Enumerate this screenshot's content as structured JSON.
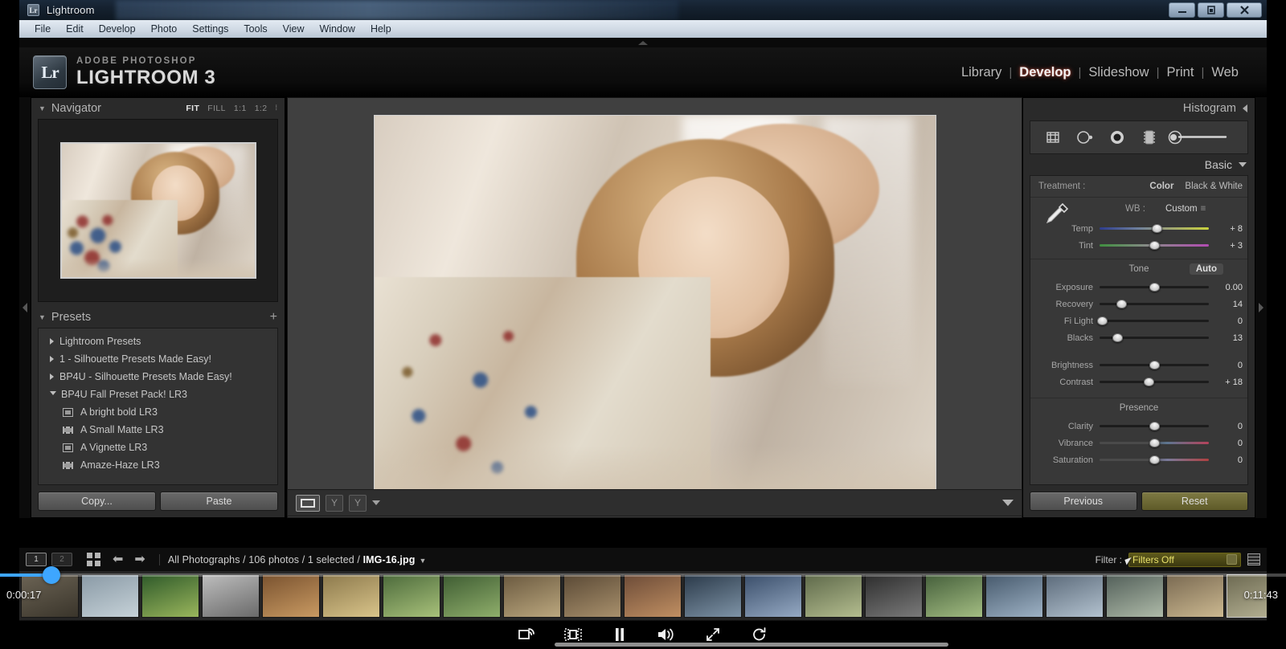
{
  "window": {
    "title": "Lightroom",
    "app_icon": "Lr",
    "minimize": "—",
    "restore": "❐",
    "close": "✕"
  },
  "menubar": {
    "items": [
      "File",
      "Edit",
      "Develop",
      "Photo",
      "Settings",
      "Tools",
      "View",
      "Window",
      "Help"
    ]
  },
  "app": {
    "brand_sub": "ADOBE PHOTOSHOP",
    "brand_main": "LIGHTROOM 3",
    "logo_mark": "Lr",
    "modules": [
      {
        "label": "Library",
        "active": false
      },
      {
        "label": "Develop",
        "active": true
      },
      {
        "label": "Slideshow",
        "active": false
      },
      {
        "label": "Print",
        "active": false
      },
      {
        "label": "Web",
        "active": false
      }
    ],
    "module_separator": "|"
  },
  "navigator": {
    "title": "Navigator",
    "zoom_levels": [
      {
        "label": "FIT",
        "active": true
      },
      {
        "label": "FILL",
        "active": false
      },
      {
        "label": "1:1",
        "active": false
      },
      {
        "label": "1:2",
        "active": false
      }
    ]
  },
  "presets": {
    "title": "Presets",
    "add_label": "+",
    "items": [
      {
        "label": "Lightroom Presets",
        "type": "folder",
        "expanded": false,
        "indent": 0
      },
      {
        "label": "1 - Silhouette Presets Made Easy!",
        "type": "folder",
        "expanded": false,
        "indent": 0
      },
      {
        "label": "BP4U - Silhouette Presets Made Easy!",
        "type": "folder",
        "expanded": false,
        "indent": 0
      },
      {
        "label": "BP4U Fall Preset Pack! LR3",
        "type": "folder",
        "expanded": true,
        "indent": 0
      },
      {
        "label": "A bright bold LR3",
        "type": "preset",
        "icon": "preset-box-icon",
        "indent": 1
      },
      {
        "label": "A Small Matte LR3",
        "type": "preset",
        "icon": "preset-bars-icon",
        "indent": 1
      },
      {
        "label": "A Vignette LR3",
        "type": "preset",
        "icon": "preset-box-icon",
        "indent": 1
      },
      {
        "label": "Amaze-Haze LR3",
        "type": "preset",
        "icon": "preset-bars-icon",
        "indent": 1
      }
    ]
  },
  "left_buttons": {
    "copy": "Copy...",
    "paste": "Paste"
  },
  "center_toolbar": {
    "view_icon": "loupe-view-icon",
    "flag_icon_1": "flag-pick-icon",
    "flag_icon_2": "flag-reject-icon",
    "caret": "caret-down-icon",
    "panel_toggle": "panel-toggle-icon"
  },
  "right_panel": {
    "histogram_title": "Histogram",
    "collapse_icon": "triangle-left-icon",
    "tools": [
      "crop-overlay-icon",
      "spot-removal-icon",
      "red-eye-icon",
      "graduated-filter-icon",
      "adjustment-brush-icon"
    ],
    "basic_title": "Basic",
    "treatment": {
      "label": "Treatment :",
      "color": "Color",
      "black_and_white": "Black & White",
      "selected": "Color"
    },
    "white_balance": {
      "label": "WB :",
      "value": "Custom",
      "eq": "≡",
      "eyedropper": "eyedropper-icon",
      "sliders": [
        {
          "name": "Temp",
          "value": "+ 8",
          "pos": 52,
          "grad": "grad-temp"
        },
        {
          "name": "Tint",
          "value": "+ 3",
          "pos": 50,
          "grad": "grad-tint"
        }
      ]
    },
    "tone": {
      "label": "Tone",
      "auto": "Auto",
      "sliders": [
        {
          "name": "Exposure",
          "value": "0.00",
          "pos": 50,
          "grad": ""
        },
        {
          "name": "Recovery",
          "value": "14",
          "pos": 20,
          "grad": ""
        },
        {
          "name": "Fi Light",
          "value": "0",
          "pos": 2,
          "grad": ""
        },
        {
          "name": "Blacks",
          "value": "13",
          "pos": 16,
          "grad": ""
        }
      ],
      "sliders2": [
        {
          "name": "Brightness",
          "value": "0",
          "pos": 50,
          "grad": ""
        },
        {
          "name": "Contrast",
          "value": "+ 18",
          "pos": 45,
          "grad": ""
        }
      ]
    },
    "presence": {
      "label": "Presence",
      "sliders": [
        {
          "name": "Clarity",
          "value": "0",
          "pos": 50,
          "grad": ""
        },
        {
          "name": "Vibrance",
          "value": "0",
          "pos": 50,
          "grad": "grad-vib"
        },
        {
          "name": "Saturation",
          "value": "0",
          "pos": 50,
          "grad": "grad-sat"
        }
      ]
    },
    "buttons": {
      "previous": "Previous",
      "reset": "Reset"
    }
  },
  "filmstrip_bar": {
    "screen_1": "1",
    "screen_2": "2",
    "grid_icon": "grid-view-icon",
    "back_icon": "arrow-left-icon",
    "forward_icon": "arrow-right-icon",
    "path_prefix": "All Photographs / 106 photos / 1 selected / ",
    "path_file": "IMG-16.jpg",
    "path_caret": "▼",
    "filter_label": "Filter :",
    "filter_value": "Filters Off",
    "filter_swatch": "filter-swatch-icon",
    "layout_icon": "filmstrip-layout-icon"
  },
  "video_player": {
    "time_current": "0:00:17",
    "time_total": "0:11:43",
    "progress_percent": 4,
    "controls": [
      {
        "name": "cast-icon",
        "glyph": "cast"
      },
      {
        "name": "theater-mode-icon",
        "glyph": "theater"
      },
      {
        "name": "pause-icon",
        "glyph": "pause"
      },
      {
        "name": "volume-icon",
        "glyph": "volume"
      },
      {
        "name": "fullscreen-icon",
        "glyph": "fullscreen"
      },
      {
        "name": "replay-icon",
        "glyph": "replay"
      }
    ]
  },
  "colors": {
    "accent_blue": "#3ea6ff",
    "panel_bg": "#2a2a2a",
    "panel_inner": "#383838",
    "center_bg": "#404040",
    "filter_yellow": "#e8e06a",
    "active_module": "#f2f2f2"
  }
}
